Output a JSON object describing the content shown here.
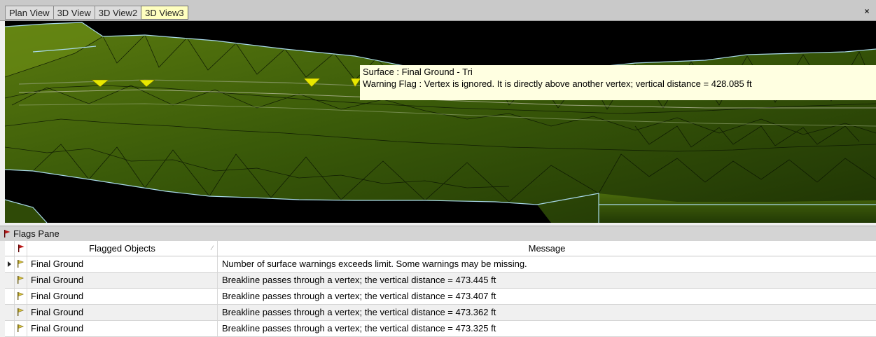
{
  "tabs": [
    {
      "label": "Plan View",
      "active": false
    },
    {
      "label": "3D View",
      "active": false
    },
    {
      "label": "3D View2",
      "active": false
    },
    {
      "label": "3D View3",
      "active": true
    }
  ],
  "window": {
    "close_glyph": "×",
    "close_icon": "close-icon"
  },
  "tooltip": {
    "line1": "Surface : Final Ground - Tri",
    "line2": "Warning Flag : Vertex is ignored. It is directly above another vertex; vertical distance = 428.085 ft"
  },
  "pane": {
    "title": "Flags Pane",
    "title_icon": "flag-icon",
    "columns": {
      "flag": "",
      "objects": "Flagged Objects",
      "message": "Message"
    },
    "rows": [
      {
        "object": "Final Ground",
        "message": "Number of surface warnings exceeds limit. Some warnings may be missing.",
        "current": true
      },
      {
        "object": "Final Ground",
        "message": "Breakline passes through a vertex; the vertical distance = 473.445 ft",
        "current": false
      },
      {
        "object": "Final Ground",
        "message": "Breakline passes through a vertex; the vertical distance = 473.407 ft",
        "current": false
      },
      {
        "object": "Final Ground",
        "message": "Breakline passes through a vertex; the vertical distance = 473.362 ft",
        "current": false
      },
      {
        "object": "Final Ground",
        "message": "Breakline passes through a vertex; the vertical distance = 473.325 ft",
        "current": false
      }
    ]
  },
  "colors": {
    "surface": "#2e4a07",
    "surface_light": "#5a7a0f",
    "triangle_edges": "#0a1402",
    "boundary": "#a8d8e8",
    "warning_flag": "#e8e800",
    "row_flag": "#d8c23a",
    "pane_flag": "#b81414",
    "active_tab": "#ffffbf"
  }
}
